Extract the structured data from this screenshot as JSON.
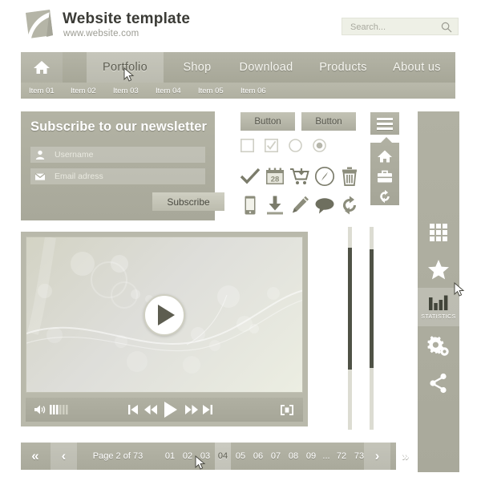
{
  "header": {
    "title": "Website template",
    "subtitle": "www.website.com",
    "logo_icon": "page-fold-logo",
    "search": {
      "placeholder": "Search...",
      "value": "",
      "icon": "search-icon"
    }
  },
  "nav": {
    "home_icon": "home-icon",
    "items": [
      {
        "label": "Portfolio",
        "active": true
      },
      {
        "label": "Shop",
        "active": false
      },
      {
        "label": "Download",
        "active": false
      },
      {
        "label": "Products",
        "active": false
      },
      {
        "label": "About us",
        "active": false
      }
    ],
    "sub_items": [
      {
        "label": "Item 01"
      },
      {
        "label": "Item 02"
      },
      {
        "label": "Item 03"
      },
      {
        "label": "Item 04"
      },
      {
        "label": "Item 05"
      },
      {
        "label": "Item 06"
      }
    ]
  },
  "newsletter": {
    "title": "Subscribe to our newsletter",
    "username": {
      "placeholder": "Username",
      "value": "",
      "icon": "user-icon"
    },
    "email": {
      "placeholder": "Email adress",
      "value": "",
      "icon": "envelope-icon"
    },
    "submit_label": "Subscribe"
  },
  "controls": {
    "buttons": [
      {
        "label": "Button"
      },
      {
        "label": "Button"
      }
    ],
    "toggles": [
      {
        "name": "checkbox-unchecked",
        "checked": false,
        "type": "checkbox"
      },
      {
        "name": "checkbox-checked",
        "checked": true,
        "type": "checkbox"
      },
      {
        "name": "radio-unselected",
        "checked": false,
        "type": "radio"
      },
      {
        "name": "radio-selected",
        "checked": true,
        "type": "radio"
      }
    ],
    "icon_row_1": [
      "check-icon",
      "calendar-icon",
      "shopping-cart-icon",
      "compass-icon",
      "trash-icon"
    ],
    "calendar_day": "28",
    "icon_row_2": [
      "mobile-phone-icon",
      "download-icon",
      "pencil-icon",
      "speech-bubble-icon",
      "refresh-icon"
    ]
  },
  "dropdown": {
    "toggle_icon": "hamburger-menu-icon",
    "items": [
      {
        "icon": "home-icon"
      },
      {
        "icon": "briefcase-icon"
      },
      {
        "icon": "refresh-icon"
      }
    ]
  },
  "sidebar": {
    "items": [
      {
        "icon": "grid-icon",
        "label": "",
        "active": false
      },
      {
        "icon": "star-icon",
        "label": "",
        "active": false
      },
      {
        "icon": "bar-chart-icon",
        "label": "STATISTICS",
        "active": true
      },
      {
        "icon": "gears-icon",
        "label": "",
        "active": false
      },
      {
        "icon": "share-icon",
        "label": "",
        "active": false
      }
    ]
  },
  "video": {
    "play_icon": "play-icon",
    "controls": [
      {
        "icon": "volume-icon"
      },
      {
        "icon": "volume-level-bars"
      },
      {
        "icon": "skip-previous-icon"
      },
      {
        "icon": "rewind-icon"
      },
      {
        "icon": "play-icon"
      },
      {
        "icon": "fast-forward-icon"
      },
      {
        "icon": "skip-next-icon"
      },
      {
        "icon": "fullscreen-icon"
      }
    ]
  },
  "sliders": [
    {
      "name": "vertical-slider-left",
      "fill_start_pct": 10,
      "fill_end_pct": 70
    },
    {
      "name": "vertical-slider-right",
      "fill_start_pct": 11,
      "fill_end_pct": 69
    }
  ],
  "pagination": {
    "first_label": "«",
    "prev_label": "‹",
    "info": "Page 2 of 73",
    "pages": [
      "01",
      "02",
      "03",
      "04",
      "05",
      "06",
      "07",
      "08",
      "09",
      "...",
      "72",
      "73"
    ],
    "active_page": "04",
    "next_label": "›",
    "last_label": "»"
  },
  "colors": {
    "nav_bg": "#a9a99a",
    "panel_bg": "#b1b1a3",
    "text_light": "#ffffff",
    "text_dark": "#3b3b36",
    "accent_dark": "#4f5246",
    "field_bg": "#eef0e6"
  }
}
